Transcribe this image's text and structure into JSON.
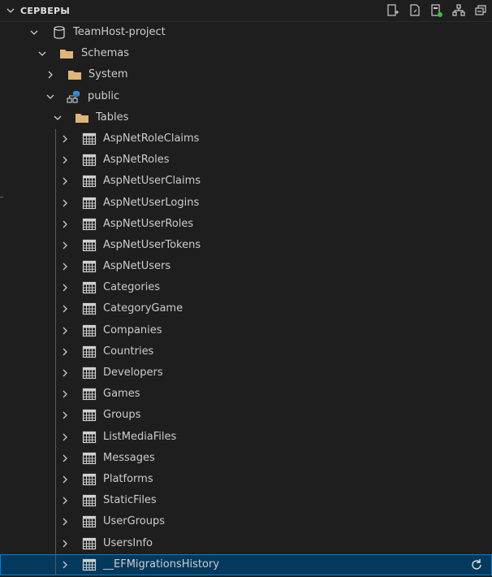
{
  "header": {
    "title": "СЕРВЕРЫ",
    "toolbar": [
      {
        "name": "new-connection-icon"
      },
      {
        "name": "new-query-icon"
      },
      {
        "name": "active-connections-icon"
      },
      {
        "name": "server-groups-icon"
      },
      {
        "name": "collapse-all-icon"
      }
    ]
  },
  "tree": {
    "server": "TeamHost-project",
    "schemas": "Schemas",
    "system": "System",
    "public": "public",
    "tables": "Tables",
    "table_items": [
      "AspNetRoleClaims",
      "AspNetRoles",
      "AspNetUserClaims",
      "AspNetUserLogins",
      "AspNetUserRoles",
      "AspNetUserTokens",
      "AspNetUsers",
      "Categories",
      "CategoryGame",
      "Companies",
      "Countries",
      "Developers",
      "Games",
      "Groups",
      "ListMediaFiles",
      "Messages",
      "Platforms",
      "StaticFiles",
      "UserGroups",
      "UsersInfo",
      "__EFMigrationsHistory"
    ],
    "selected_table": "__EFMigrationsHistory"
  },
  "colors": {
    "background": "#1e1e1e",
    "selected_bg": "#04395e",
    "selected_border": "#007fd4",
    "folder": "#dcb67a",
    "text": "#cccccc"
  }
}
